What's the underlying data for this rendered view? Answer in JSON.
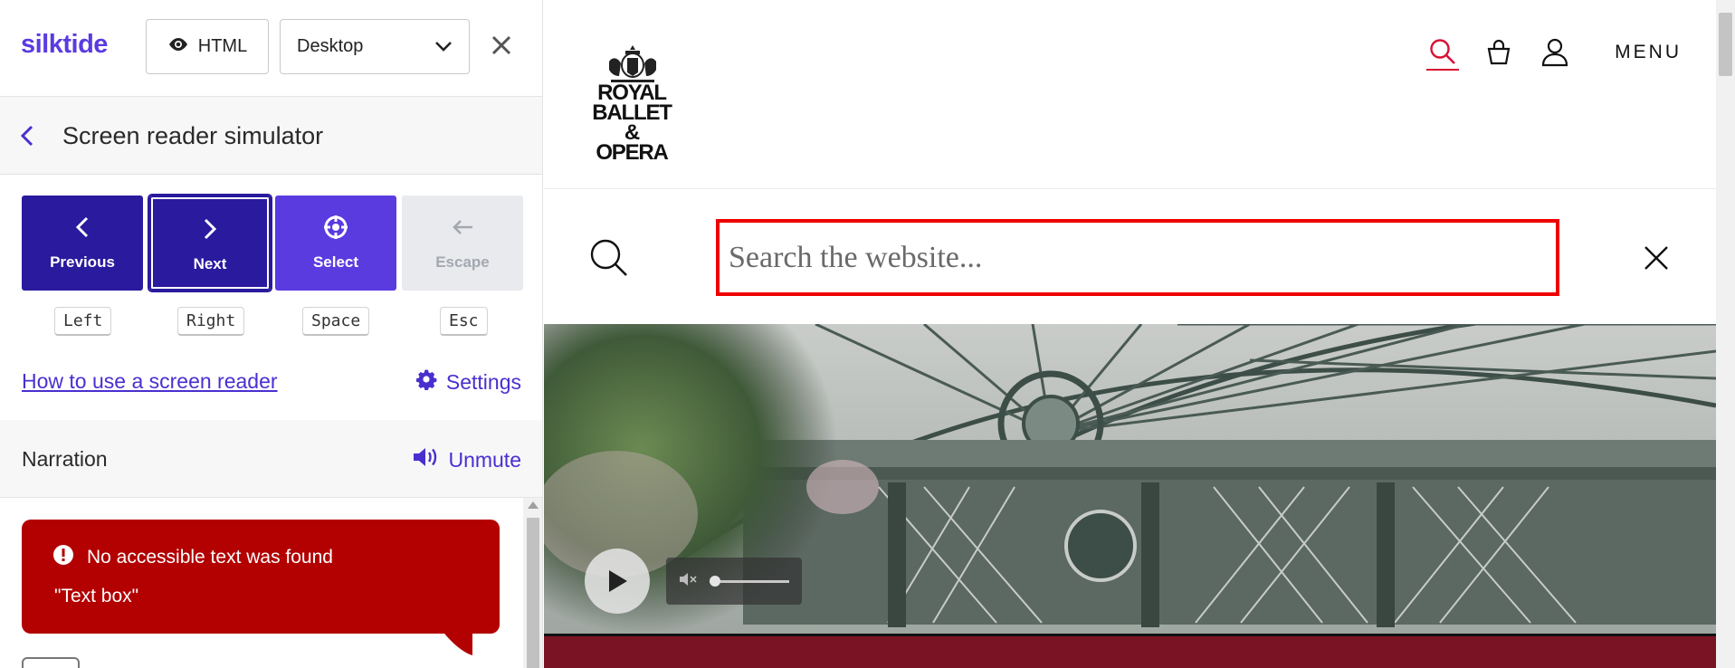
{
  "panel": {
    "logo": "silktide",
    "html_button": "HTML",
    "view_select": "Desktop",
    "subheader_title": "Screen reader simulator",
    "nav_buttons": [
      {
        "label": "Previous",
        "key": "Left"
      },
      {
        "label": "Next",
        "key": "Right"
      },
      {
        "label": "Select",
        "key": "Space"
      },
      {
        "label": "Escape",
        "key": "Esc"
      }
    ],
    "howto_link": "How to use a screen reader",
    "settings_label": "Settings",
    "narration_title": "Narration",
    "unmute_label": "Unmute",
    "bubble": {
      "warning": "No accessible text was found",
      "role": "\"Text box\""
    }
  },
  "site": {
    "logo_lines": [
      "ROYAL",
      "BALLET &",
      "OPERA"
    ],
    "menu_label": "MENU",
    "search_placeholder": "Search the website...",
    "accent_color": "#d81133",
    "band_color": "#7a1424"
  },
  "colors": {
    "brand": "#5a3be0",
    "dark_brand": "#2a1a9e",
    "alert": "#b30000",
    "highlight": "#ee0000"
  }
}
